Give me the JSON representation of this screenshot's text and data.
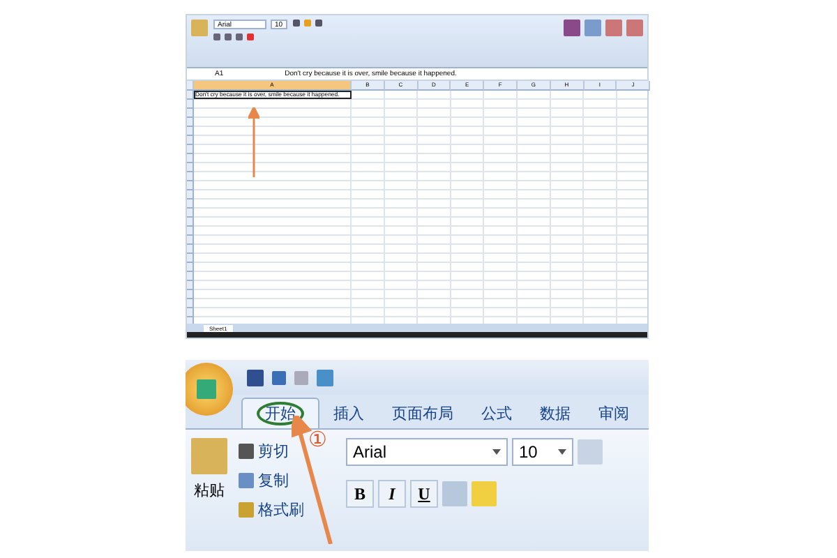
{
  "top_screenshot": {
    "font": "Arial",
    "font_size": "10",
    "name_box": "A1",
    "formula": "Don't cry because it is over, smile because it happened.",
    "columns": [
      "A",
      "B",
      "C",
      "D",
      "E",
      "F",
      "G",
      "H",
      "I",
      "J"
    ],
    "cell_a1": {
      "text": "Don't cry because it is over, smile because it happened.",
      "selected": true
    },
    "sheet_tab": "Sheet1"
  },
  "bottom_screenshot": {
    "tabs": [
      {
        "label": "开始",
        "selected": true
      },
      {
        "label": "插入",
        "selected": false
      },
      {
        "label": "页面布局",
        "selected": false
      },
      {
        "label": "公式",
        "selected": false
      },
      {
        "label": "数据",
        "selected": false
      },
      {
        "label": "审阅",
        "selected": false
      }
    ],
    "paste": "粘贴",
    "clipboard_items": [
      {
        "kind": "cut",
        "label": "剪切"
      },
      {
        "kind": "copy",
        "label": "复制"
      },
      {
        "kind": "brush",
        "label": "格式刷"
      }
    ],
    "font": "Arial",
    "font_size": "10",
    "format_buttons": [
      {
        "kind": "bold",
        "label": "B"
      },
      {
        "kind": "italic",
        "label": "I"
      },
      {
        "kind": "underline",
        "label": "U"
      }
    ],
    "callout": "①"
  }
}
